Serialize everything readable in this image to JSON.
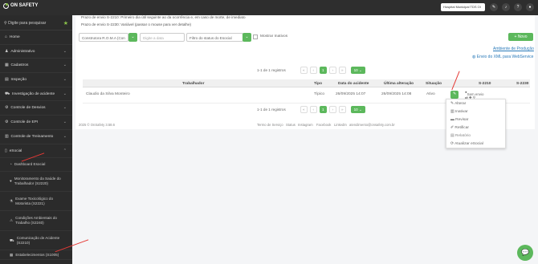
{
  "app": {
    "brand": "ON SAFETY",
    "hospital": "Hospital Municipal TDS Ol"
  },
  "sidebar": {
    "search_placeholder": "Digite para pesquisar",
    "items": [
      {
        "label": "Home"
      },
      {
        "label": "Administrativo"
      },
      {
        "label": "Cadastros"
      },
      {
        "label": "Inspeção"
      },
      {
        "label": "Investigação de acidente"
      },
      {
        "label": "Controle de Desvios"
      },
      {
        "label": "Controle de EPI"
      },
      {
        "label": "Controle de Treinamento"
      },
      {
        "label": "eSocial"
      }
    ],
    "subitems": [
      {
        "label": "Dashboard Esocial"
      },
      {
        "label": "Monitoramento da Saúde do Trabalhador (S2220)"
      },
      {
        "label": "Exame Toxicológico do Motorista (S2221)"
      },
      {
        "label": "Condições Ambientais do Trabalho (S2240)"
      },
      {
        "label": "Comunicação de Acidente (S2210)"
      },
      {
        "label": "Estabelecimentos (S1005)"
      }
    ]
  },
  "main": {
    "note1": "Prazo de envio S-2210: Primeiro dia útil seguinte ao da ocorrência e, em caso de morte, de imediato",
    "note2": "Prazo de envio S-2230: Variável (passar o mouse para ver detalhe)",
    "filters": {
      "company": "Construtora R.O.M.A (Con",
      "date_placeholder": "Digite a data",
      "status_placeholder": "Filtro do status do Esocial",
      "show_inactive": "Mostrar Inativos"
    },
    "new_button": "Novo",
    "link_env": "Ambiente de Produção",
    "link_xml": "Envio do XML para WebService",
    "pager": {
      "summary": "1-1 de 1 registros",
      "page": "1",
      "per_page": "10"
    },
    "table": {
      "headers": [
        "Trabalhador",
        "Tipo",
        "Data do acidente",
        "Última alteração",
        "Situação",
        "S-2210",
        "S-2230"
      ],
      "rows": [
        {
          "worker": "Claudio da Silva Monteiro",
          "type": "Típico",
          "date": "26/09/2025 14:07",
          "updated": "26/09/2025 14:08",
          "status": "Ativo",
          "s2210": "Sem envio"
        }
      ]
    },
    "menu": [
      "Alterar",
      "Inativar",
      "Revisar",
      "Retificar",
      "Relatório",
      "Atualizar eSocial"
    ],
    "footer": {
      "copy": "2025 © OnSafety 3.58.6",
      "links": [
        "Termo de Serviço",
        "Status",
        "Instagram",
        "Facebook",
        "LinkedIn",
        "atendimento@onsafety.com.br"
      ]
    }
  },
  "colors": {
    "accent": "#5cb85c",
    "sidebar": "#2b2b2b",
    "topbar": "#2e2e2e",
    "annotation": "#e53935"
  }
}
